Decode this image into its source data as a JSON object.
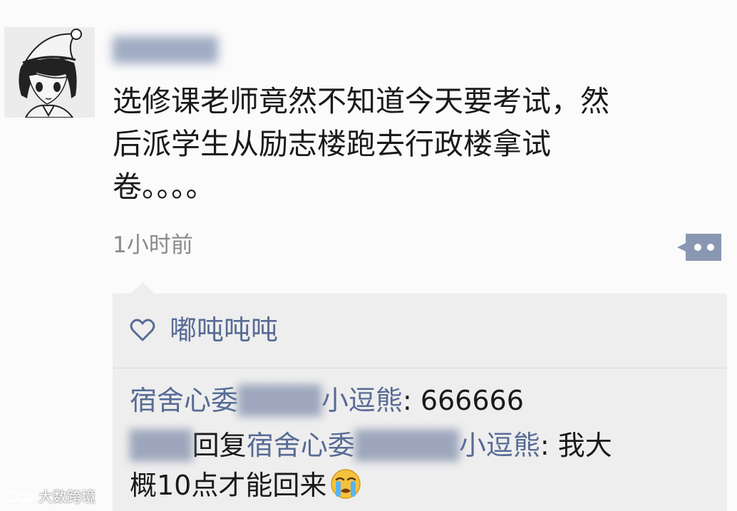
{
  "post": {
    "author_name": "██████",
    "text_lines": [
      "选修课老师竟然不知道今天要考试，然",
      "后派学生从励志楼跑去行政楼拿试",
      "卷。。。。"
    ],
    "time": "1小时前"
  },
  "likes": {
    "names": "嘟吨吨吨"
  },
  "comments": [
    {
      "author": "宿舍心委",
      "author_blurred": "████",
      "author_suffix": "小逗熊",
      "separator": ": ",
      "text": "666666"
    },
    {
      "replier_blurred": "███",
      "reply_word": "回复",
      "reply_to": "宿舍心委",
      "reply_to_blurred": "█████",
      "reply_to_suffix": "小逗熊",
      "separator": ": ",
      "text_line1": "我大",
      "text_line2": "概10点才能回来"
    }
  ],
  "watermark": {
    "text": "大数跨境"
  },
  "icons": {
    "heart": "heart-outline-icon",
    "more": "comment-more-icon",
    "emoji": "crying-face-emoji"
  },
  "colors": {
    "link": "#576b95",
    "text": "#1a1a1a",
    "time": "#8a8a8a",
    "panel": "#eeeeee",
    "more_button": "#8a97b2"
  }
}
